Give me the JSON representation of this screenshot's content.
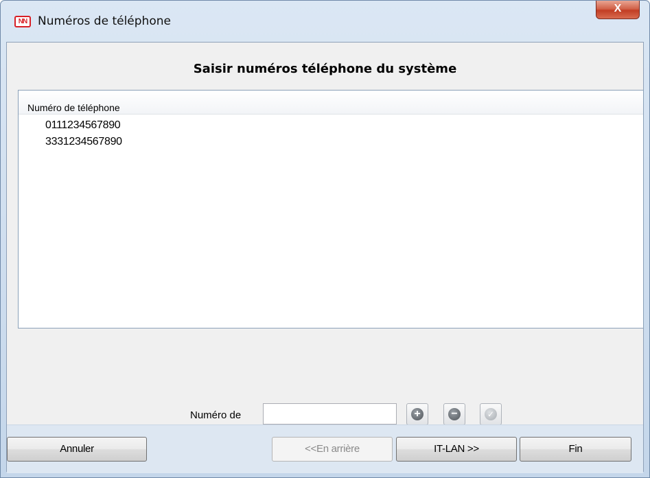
{
  "window": {
    "title": "Numéros de téléphone",
    "icon": "app-logo-icon",
    "icon_text": "NN",
    "close_label": "X"
  },
  "page": {
    "heading": "Saisir numéros téléphone du système"
  },
  "list": {
    "column_header": "Numéro de téléphone",
    "items": [
      "0111234567890",
      "3331234567890"
    ]
  },
  "entry": {
    "label": "Numéro de",
    "input_value": "",
    "add_icon": "plus-circle-icon",
    "remove_icon": "minus-circle-icon",
    "confirm_icon": "check-circle-icon"
  },
  "footer": {
    "cancel_label": "Annuler",
    "back_label": "<<En arrière",
    "next_label": "IT-LAN >>",
    "finish_label": "Fin"
  },
  "colors": {
    "close_button": "#c23d24",
    "logo": "#d81f26",
    "footer_bg": "#dde7f2"
  }
}
